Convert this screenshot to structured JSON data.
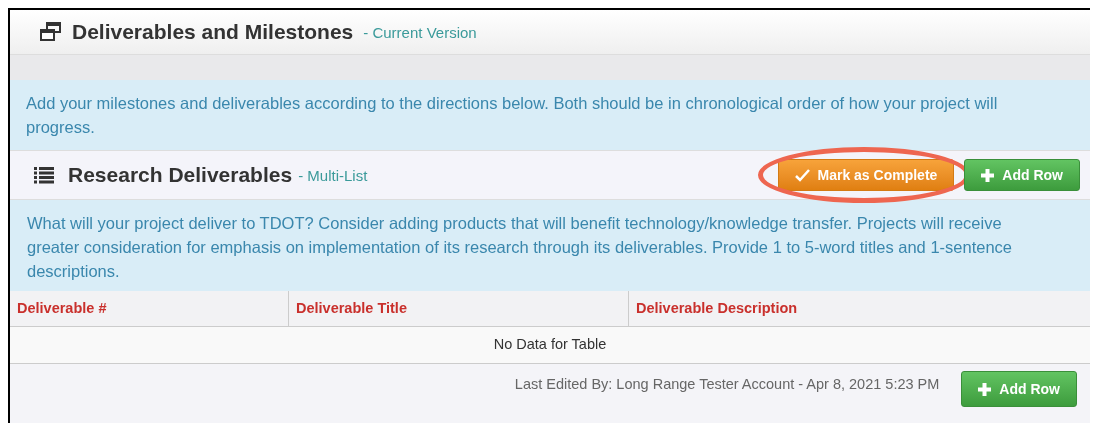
{
  "page_header": {
    "title": "Deliverables and Milestones",
    "subtitle": "- Current Version"
  },
  "intro": "Add your milestones and deliverables according to the directions below. Both should be in chronological order of how your project will progress.",
  "section": {
    "title": "Research Deliverables",
    "subtitle": "- Multi-List",
    "buttons": [
      {
        "kind": "complete",
        "label": "Mark as Complete",
        "highlighted": true
      },
      {
        "kind": "add",
        "label": "Add Row",
        "highlighted": false
      }
    ],
    "instructions": "What will your project deliver to TDOT? Consider adding products that will benefit technology/knowledge transfer. Projects will receive greater consideration for emphasis on implementation of its research through its deliverables. Provide 1 to 5-word titles and 1-sentence descriptions.",
    "table": {
      "columns": [
        "Deliverable #",
        "Deliverable Title",
        "Deliverable Description"
      ],
      "empty_message": "No Data for Table"
    },
    "footer": {
      "last_edited": "Last Edited By: Long Range Tester Account - Apr 8, 2021 5:23 PM",
      "button": {
        "kind": "add",
        "label": "Add Row"
      }
    }
  }
}
